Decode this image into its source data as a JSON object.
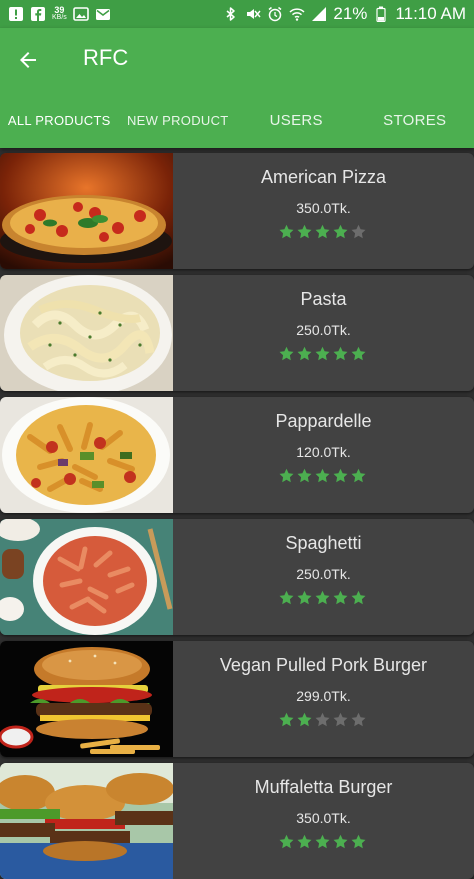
{
  "status_bar": {
    "speed_value": "39",
    "speed_unit": "KB/s",
    "battery_percent": "21%",
    "time": "11:10 AM"
  },
  "app_bar": {
    "title": "RFC",
    "accent_color": "#4caf50"
  },
  "tabs": [
    {
      "label": "ALL PRODUCTS",
      "active": true
    },
    {
      "label": "NEW PRODUCT",
      "active": false
    },
    {
      "label": "USERS",
      "active": false
    },
    {
      "label": "STORES",
      "active": false
    }
  ],
  "products": [
    {
      "name": "American Pizza",
      "price": "350.0Tk.",
      "rating": 4,
      "image": "pizza"
    },
    {
      "name": "Pasta",
      "price": "250.0Tk.",
      "rating": 5,
      "image": "fettuccine"
    },
    {
      "name": "Pappardelle",
      "price": "120.0Tk.",
      "rating": 5,
      "image": "penne-veg"
    },
    {
      "name": "Spaghetti",
      "price": "250.0Tk.",
      "rating": 5,
      "image": "penne-tomato"
    },
    {
      "name": "Vegan Pulled Pork Burger",
      "price": "299.0Tk.",
      "rating": 2,
      "image": "burger"
    },
    {
      "name": "Muffaletta Burger",
      "price": "350.0Tk.",
      "rating": 5,
      "image": "burgers"
    }
  ]
}
